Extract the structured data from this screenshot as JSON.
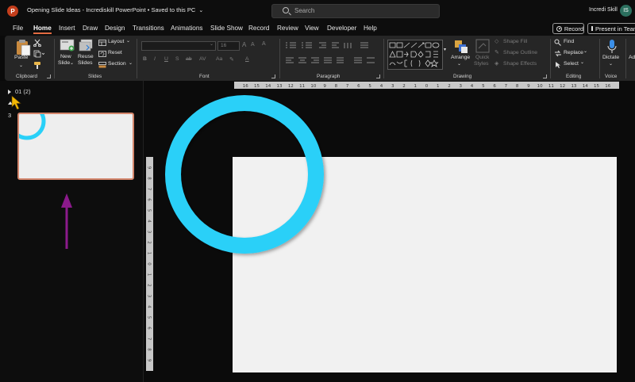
{
  "titlebar": {
    "app_icon_letter": "P",
    "document_title": "Opening Slide Ideas - Incrediskill PowerPoint • Saved to this PC",
    "title_chevron": "⌄",
    "search_placeholder": "Search",
    "user_name": "Incredi Skill",
    "user_initials": "IS"
  },
  "tabs": [
    {
      "label": "File"
    },
    {
      "label": "Home",
      "active": true
    },
    {
      "label": "Insert"
    },
    {
      "label": "Draw"
    },
    {
      "label": "Design"
    },
    {
      "label": "Transitions"
    },
    {
      "label": "Animations"
    },
    {
      "label": "Slide Show"
    },
    {
      "label": "Record"
    },
    {
      "label": "Review"
    },
    {
      "label": "View"
    },
    {
      "label": "Developer"
    },
    {
      "label": "Help"
    }
  ],
  "record_button": "Record",
  "present_button": "Present in Teams",
  "ribbon": {
    "clipboard": {
      "label": "Clipboard",
      "paste": "Paste"
    },
    "slides": {
      "label": "Slides",
      "new_slide_1": "New",
      "new_slide_2": "Slide",
      "reuse_1": "Reuse",
      "reuse_2": "Slides",
      "layout": "Layout",
      "reset": "Reset",
      "section": "Section"
    },
    "font": {
      "label": "Font",
      "font_size": "16"
    },
    "paragraph": {
      "label": "Paragraph"
    },
    "drawing": {
      "label": "Drawing",
      "arrange": "Arrange",
      "quick_styles_1": "Quick",
      "quick_styles_2": "Styles",
      "shape_fill": "Shape Fill",
      "shape_outline": "Shape Outline",
      "shape_effects": "Shape Effects"
    },
    "editing": {
      "label": "Editing",
      "find": "Find",
      "replace": "Replace",
      "select": "Select"
    },
    "voice": {
      "label": "Voice",
      "dictate": "Dictate"
    },
    "addins": {
      "label": "Ad"
    }
  },
  "slides_pane": {
    "section_name": "01 (2)",
    "slide_number": "3"
  },
  "colors": {
    "accent": "#e36b42",
    "ring": "#29d0f8",
    "annotation_arrow": "#8b1a8b",
    "cursor": "#f2b705"
  }
}
